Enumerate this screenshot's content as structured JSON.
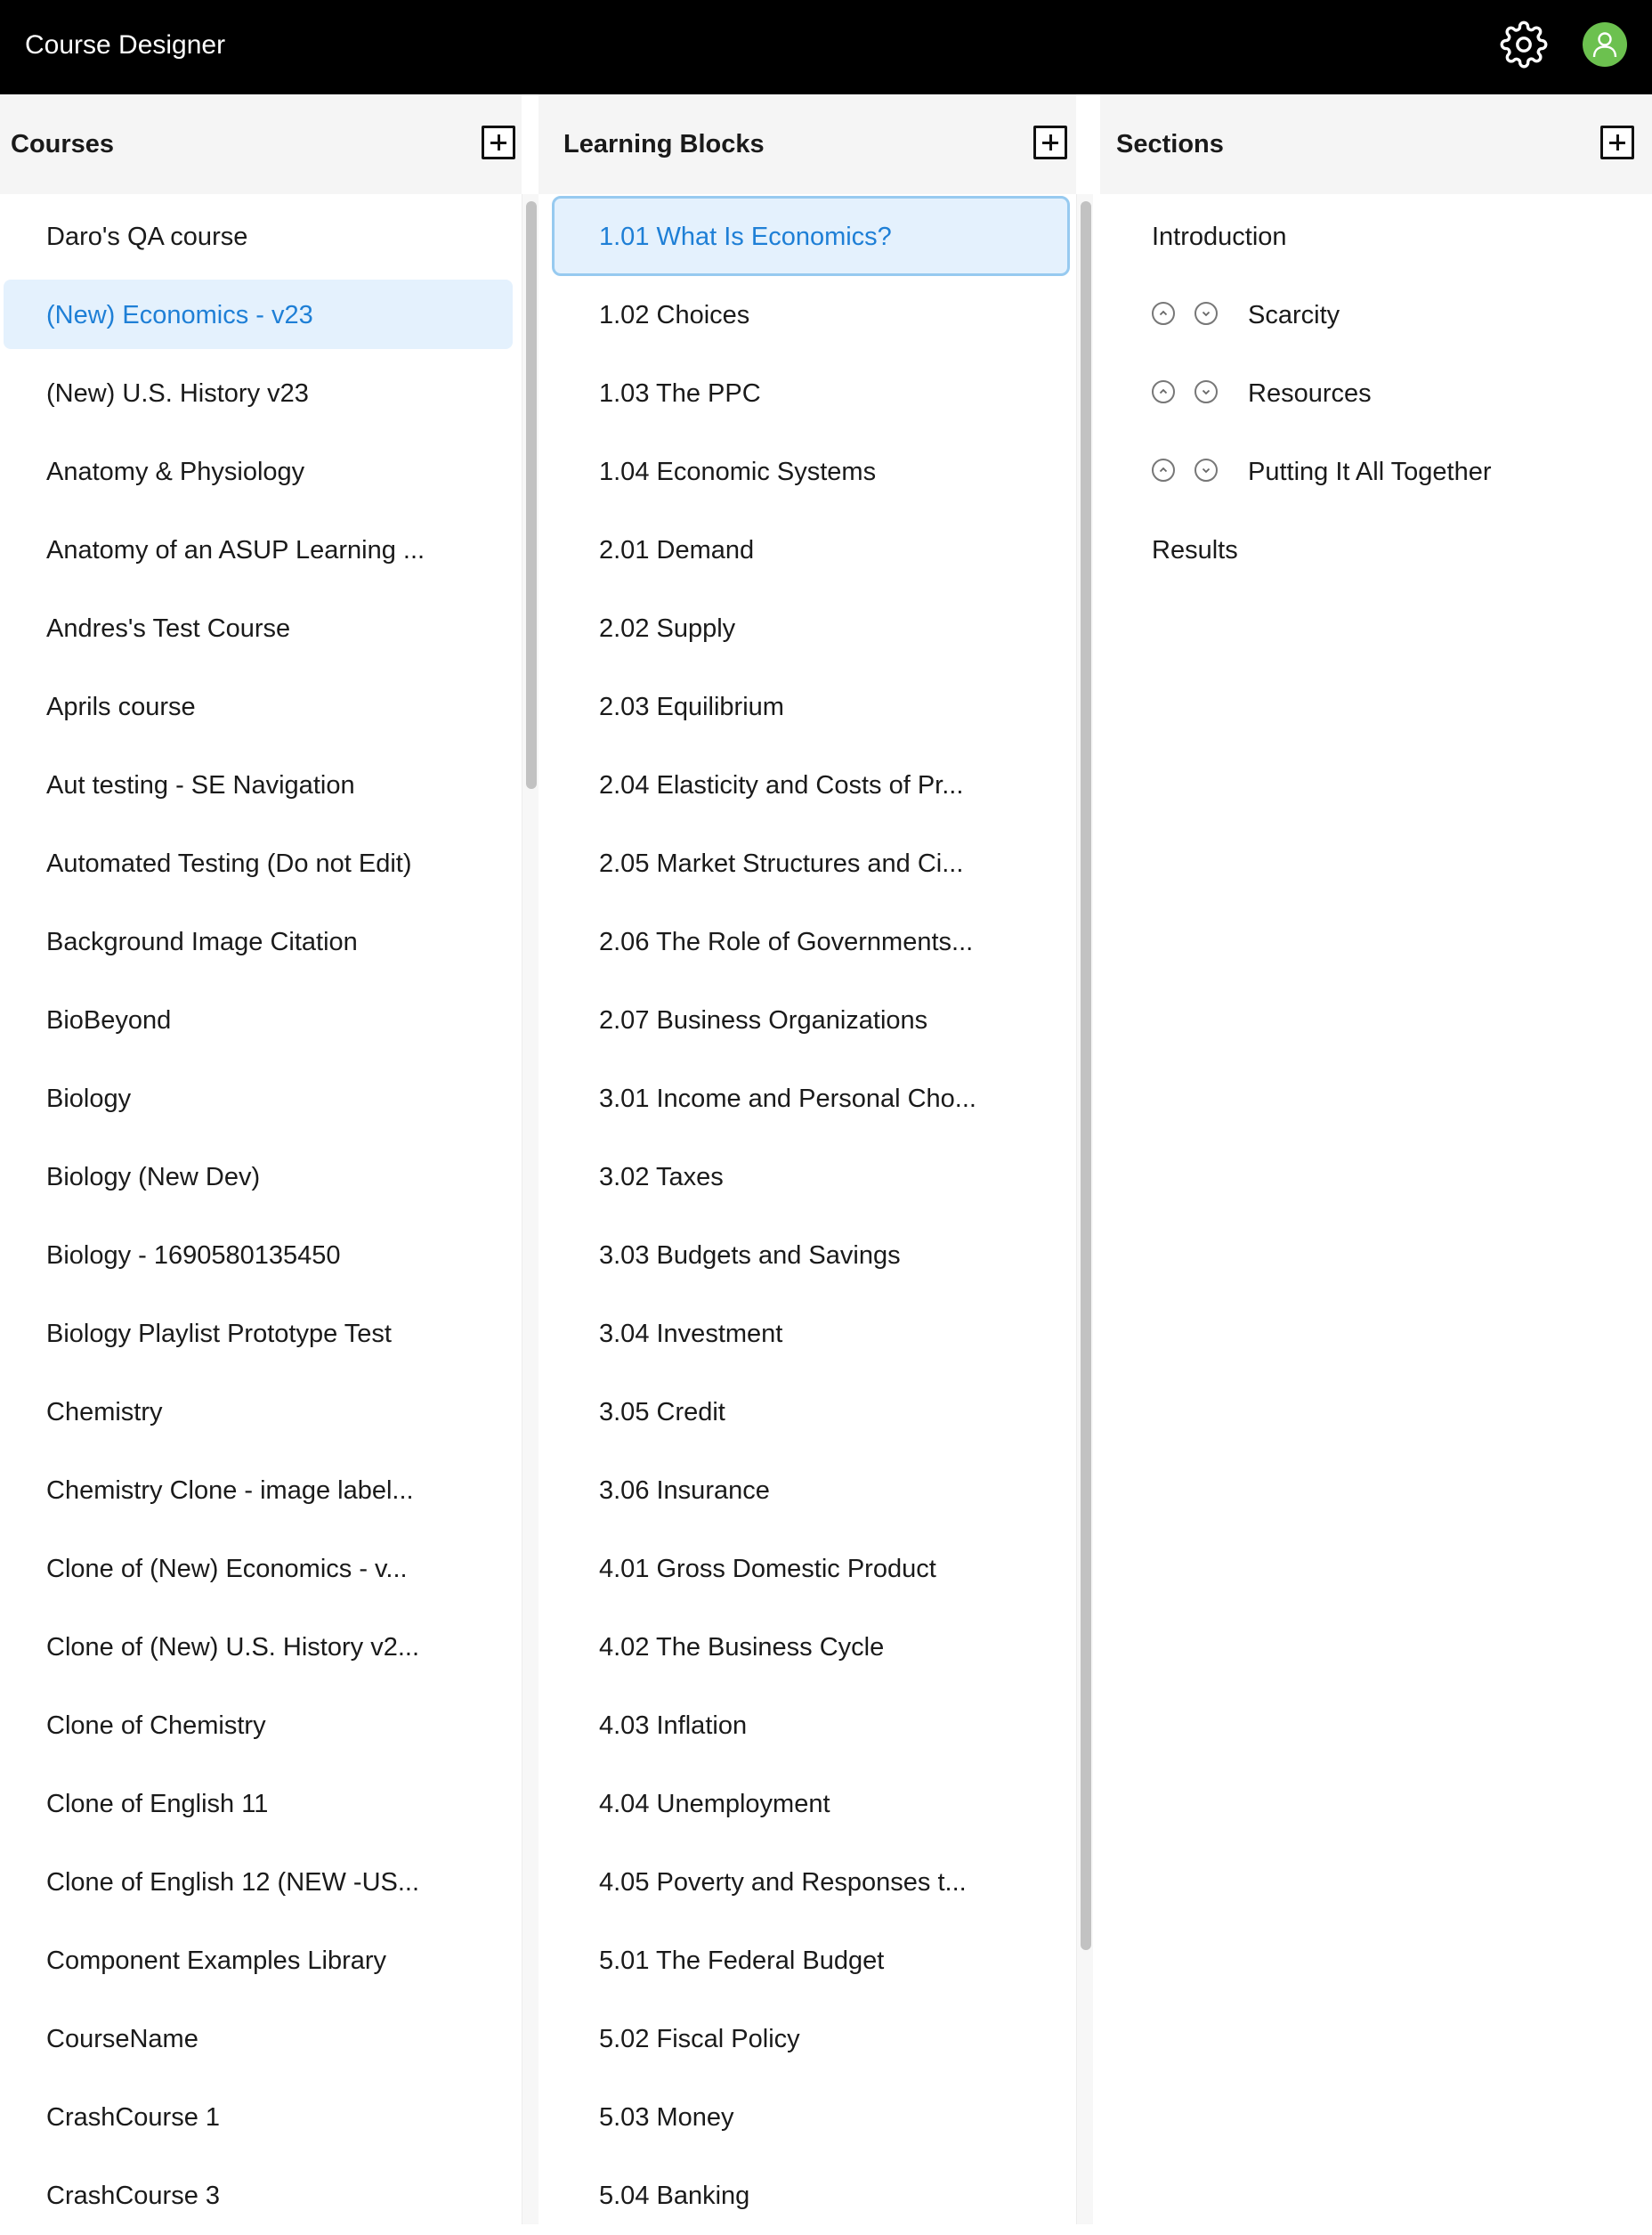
{
  "app": {
    "title": "Course Designer"
  },
  "topbar": {
    "settings_icon": "gear-icon",
    "avatar_icon": "user-icon",
    "avatar_color": "#6cc14f"
  },
  "courses": {
    "title": "Courses",
    "items": [
      "Daro's QA course",
      "(New) Economics - v23",
      "(New) U.S. History v23",
      "Anatomy & Physiology",
      "Anatomy of an ASUP Learning ...",
      "Andres's Test Course",
      "Aprils course",
      "Aut testing - SE Navigation",
      "Automated Testing (Do not Edit)",
      "Background Image Citation",
      "BioBeyond",
      "Biology",
      "Biology (New Dev)",
      "Biology - 1690580135450",
      "Biology Playlist Prototype Test",
      "Chemistry",
      "Chemistry Clone - image label...",
      "Clone of (New) Economics - v...",
      "Clone of (New) U.S. History v2...",
      "Clone of Chemistry",
      "Clone of English 11",
      "Clone of English 12 (NEW -US...",
      "Component Examples Library",
      "CourseName",
      "CrashCourse 1",
      "CrashCourse 3"
    ],
    "selected": "(New) Economics - v23"
  },
  "blocks": {
    "title": "Learning Blocks",
    "items": [
      "1.01 What Is Economics?",
      "1.02 Choices",
      "1.03 The PPC",
      "1.04 Economic Systems",
      "2.01 Demand",
      "2.02 Supply",
      "2.03 Equilibrium",
      "2.04 Elasticity and Costs of Pr...",
      "2.05 Market Structures and Ci...",
      "2.06 The Role of Governments...",
      "2.07 Business Organizations",
      "3.01 Income and Personal Cho...",
      "3.02 Taxes",
      "3.03 Budgets and Savings",
      "3.04 Investment",
      "3.05 Credit",
      "3.06 Insurance",
      "4.01 Gross Domestic Product",
      "4.02 The Business Cycle",
      "4.03 Inflation",
      "4.04 Unemployment",
      "4.05 Poverty and Responses t...",
      "5.01 The Federal Budget",
      "5.02 Fiscal Policy",
      "5.03 Money",
      "5.04 Banking"
    ],
    "selected": "1.01 What Is Economics?"
  },
  "sections": {
    "title": "Sections",
    "items": [
      {
        "label": "Introduction",
        "reorderable": false
      },
      {
        "label": "Scarcity",
        "reorderable": true
      },
      {
        "label": "Resources",
        "reorderable": true
      },
      {
        "label": "Putting It All Together",
        "reorderable": true
      },
      {
        "label": "Results",
        "reorderable": false
      }
    ]
  },
  "colors": {
    "selected_text": "#1e7fd6",
    "selected_bg": "#e4f1fd",
    "selected_border": "#97caf0",
    "header_bg": "#f5f5f5"
  }
}
